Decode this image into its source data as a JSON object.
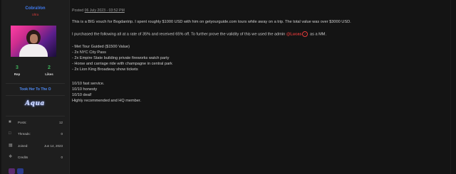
{
  "profile": {
    "username": "CobraVon",
    "title": "Ultra",
    "rep_value": "3",
    "rep_label": "Rep",
    "likes_value": "2",
    "likes_label": "Likes",
    "tagline": "Took Her To The O",
    "signature_text": "Aqua",
    "info": [
      {
        "icon": "chat-icon",
        "label": "Posts:",
        "value": "12"
      },
      {
        "icon": "threads-icon",
        "label": "Threads:",
        "value": "0"
      },
      {
        "icon": "calendar-icon",
        "label": "Joined:",
        "value": "Jun 14, 2023"
      },
      {
        "icon": "credits-icon",
        "label": "Credits",
        "value": "0"
      }
    ]
  },
  "post": {
    "posted_prefix": "Posted",
    "posted_date": "06 July 2023 - 03:52 PM",
    "p1": "This is a BIG vouch for Bogdantrip. I spent roughly $1000 USD with him on getyourguide.com tours while away on a trip. The total value was over $3000 USD.",
    "p2_before": "I purchased the following all at a rate of 35% and received 65% off. To further prove the validity of this we used the admin",
    "p2_mention": "@Lucas",
    "p2_after": "as a MM.",
    "list": [
      "- Met Tour Guided ($1500 Value)",
      "- 2x NYC City Pass",
      "- 2x Empire State building private fireworks watch party",
      "- Horse and carriage ride with champagne in central park",
      "- 2x Lion King Broadway show tickets"
    ],
    "closing": [
      "10/10 fast service.",
      "10/10 honesty",
      "10/10 deal!",
      "Highly recommended and HQ member."
    ]
  },
  "colors": {
    "username": "#3f7bf0",
    "usertitle": "#d33a3a",
    "stat_number": "#3fb25b",
    "mention": "#e23a3a"
  }
}
